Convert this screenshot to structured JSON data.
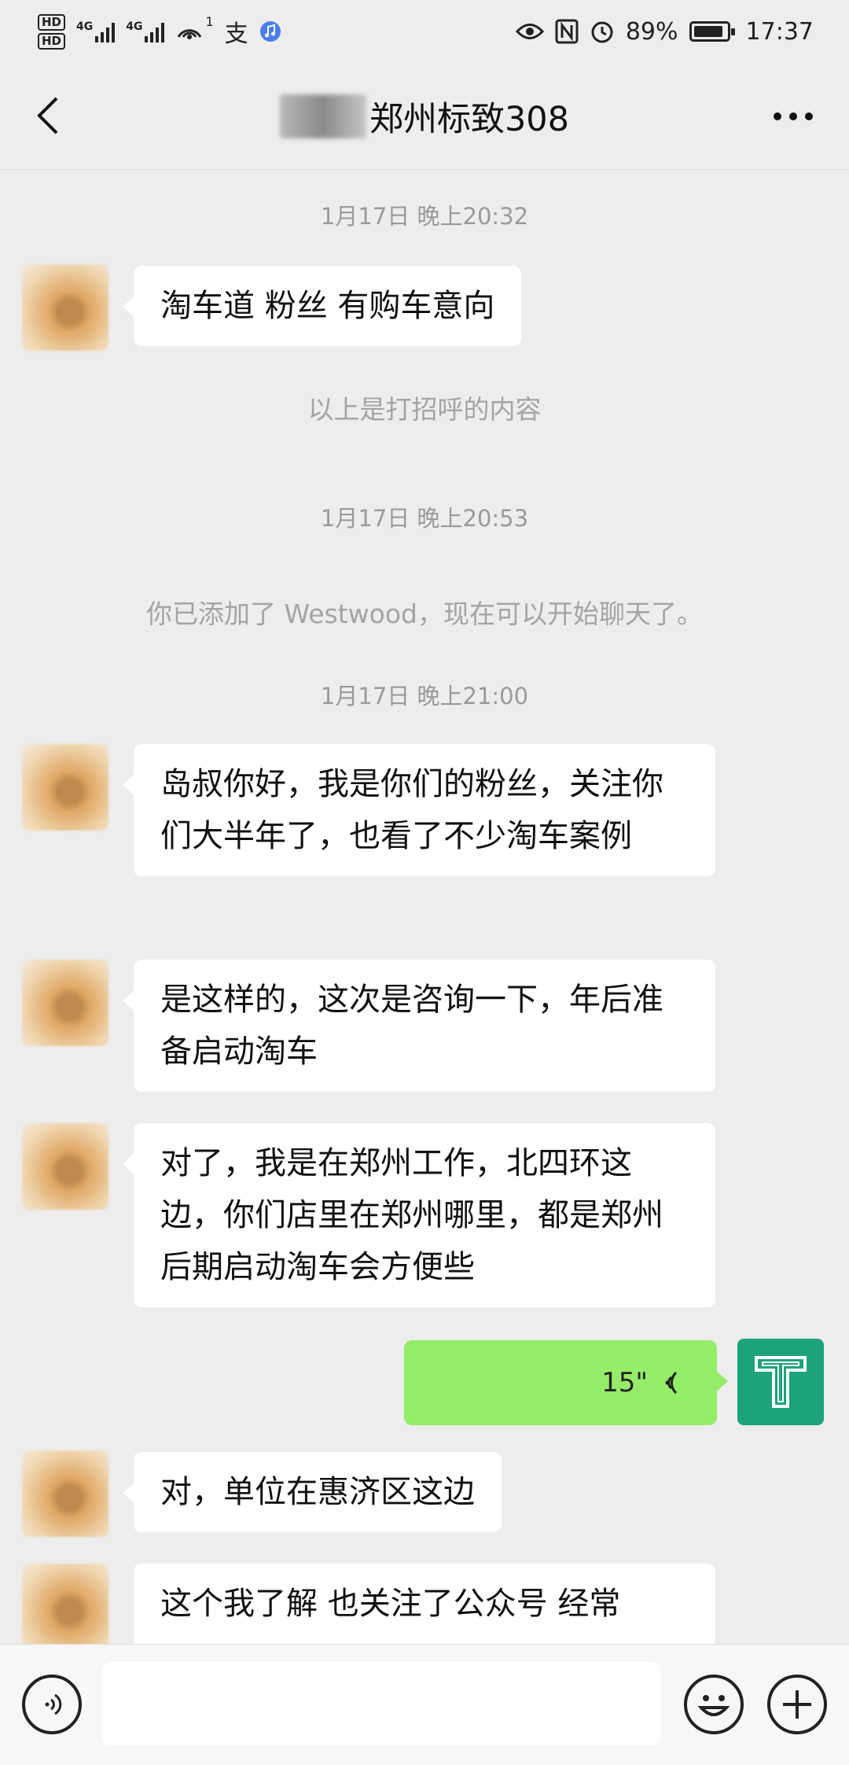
{
  "status_bar": {
    "hd1": "HD",
    "hd2": "HD",
    "net1": "4G",
    "net2": "4G",
    "wifi_badge": "1",
    "alipay_glyph": "支",
    "battery_percent": "89%",
    "battery_level": 0.89,
    "time": "17:37"
  },
  "header": {
    "title": "郑州标致308"
  },
  "messages": {
    "time1": "1月17日 晚上20:32",
    "msg1": "淘车道 粉丝 有购车意向",
    "sys1": "以上是打招呼的内容",
    "time2": "1月17日 晚上20:53",
    "sys2": "你已添加了 Westwood，现在可以开始聊天了。",
    "time3": "1月17日 晚上21:00",
    "msg2": "岛叔你好，我是你们的粉丝，关注你们大半年了，也看了不少淘车案例",
    "msg3": "是这样的，这次是咨询一下，年后准备启动淘车",
    "msg4": "对了，我是在郑州工作，北四环这边，你们店里在郑州哪里，都是郑州 后期启动淘车会方便些",
    "voice_duration": "15\"",
    "msg5": "对，单位在惠济区这边",
    "msg6": "这个我了解 也关注了公众号 经常"
  },
  "colors": {
    "background": "#ededed",
    "my_bubble": "#95ec69",
    "my_avatar": "#1ea27a"
  },
  "icons": [
    "back-arrow-icon",
    "more-icon",
    "eye-icon",
    "nfc-icon",
    "alarm-icon",
    "voice-icon",
    "emoji-icon",
    "plus-icon"
  ]
}
